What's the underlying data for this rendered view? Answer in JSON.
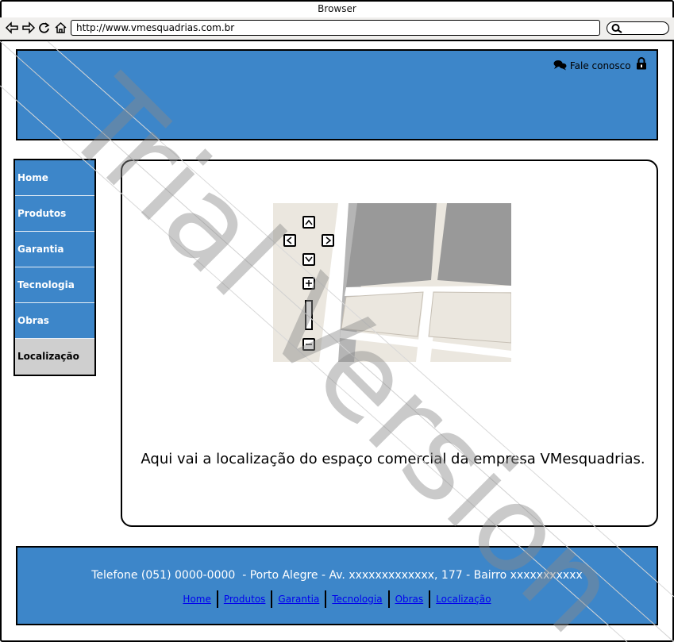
{
  "browser": {
    "title": "Browser",
    "url": "http://www.vmesquadrias.com.br",
    "nav_icons": [
      "back-arrow-icon",
      "forward-arrow-icon",
      "reload-icon",
      "home-icon"
    ]
  },
  "header": {
    "contact_label": "Fale conosco",
    "contact_icon": "speech-bubbles-icon",
    "lock_icon": "lock-icon"
  },
  "sidebar": {
    "items": [
      {
        "label": "Home"
      },
      {
        "label": "Produtos"
      },
      {
        "label": "Garantia"
      },
      {
        "label": "Tecnologia"
      },
      {
        "label": "Obras"
      },
      {
        "label": "Localização",
        "active": true
      }
    ]
  },
  "content": {
    "map_controls": [
      "up",
      "left",
      "right",
      "down",
      "zoom-in",
      "zoom-slider",
      "zoom-out"
    ],
    "caption": "Aqui vai a localização do espaço comercial da empresa VMesquadrias."
  },
  "footer": {
    "info": "Telefone (051) 0000-0000  - Porto Alegre - Av. xxxxxxxxxxxxx, 177 - Bairro xxxxxxxxxxx",
    "links": [
      "Home",
      "Produtos",
      "Garantia",
      "Tecnologia",
      "Obras",
      "Localização"
    ]
  },
  "watermark": {
    "text": "Trial Version"
  },
  "colors": {
    "primary": "#3d86c9",
    "active_nav": "#cfcfcf",
    "chrome": "#f0efed",
    "map_building": "#999999",
    "map_land": "#ebe7df"
  }
}
